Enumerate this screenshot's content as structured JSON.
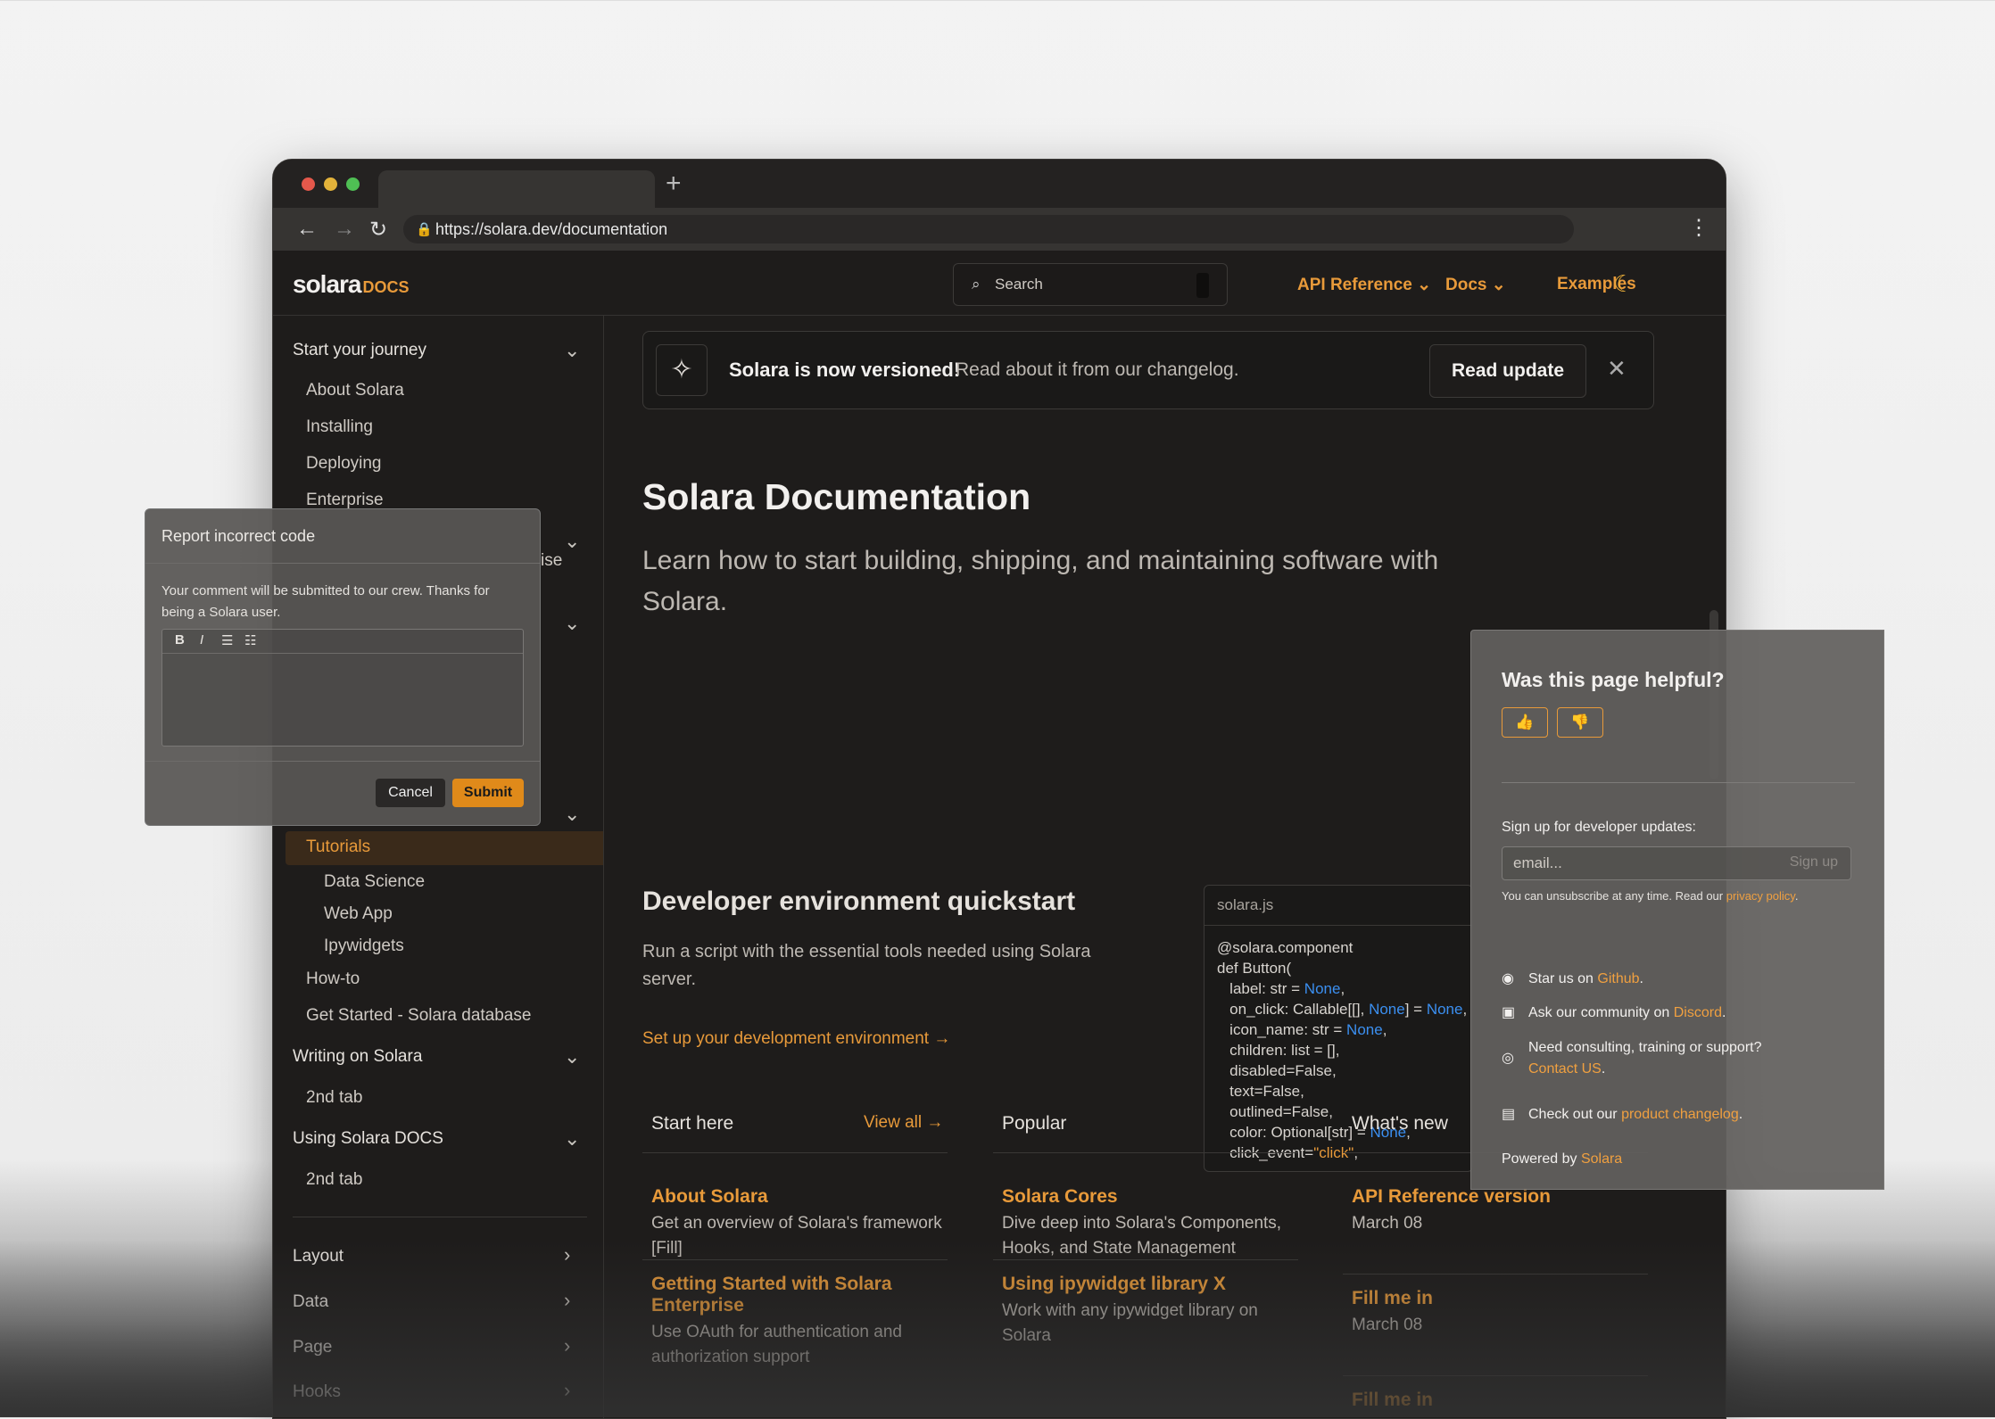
{
  "browser": {
    "url": "https://solara.dev/documentation",
    "dots": [
      "#e5584b",
      "#e2b23a",
      "#4fbf54"
    ]
  },
  "header": {
    "logo": "solara",
    "logo_suffix": "DOCS",
    "search_placeholder": "Search",
    "nav": [
      {
        "label": "API Reference"
      },
      {
        "label": "Docs"
      },
      {
        "label": "Examples"
      }
    ]
  },
  "sidebar": {
    "sections": [
      {
        "label": "Start your journey",
        "items": [
          "About Solara",
          "Installing",
          "Deploying",
          "Enterprise"
        ]
      },
      {
        "partial": "ise"
      },
      {
        "active": "Tutorials",
        "children": [
          "Data Science",
          "Web App",
          "Ipywidgets"
        ],
        "more": [
          "How-to",
          "Get Started - Solara database"
        ]
      },
      {
        "label": "Writing on Solara",
        "items": [
          "2nd tab"
        ]
      },
      {
        "label": "Using Solara DOCS",
        "items": [
          "2nd tab"
        ]
      }
    ],
    "bottom": [
      "Layout",
      "Data",
      "Page",
      "Hooks"
    ]
  },
  "banner": {
    "title": "Solara is now versioned!",
    "text": "Read about it from our changelog.",
    "button": "Read update"
  },
  "main": {
    "title": "Solara Documentation",
    "lead": "Learn how to start building, shipping, and maintaining software with Solara.",
    "quickstart_title": "Developer environment quickstart",
    "quickstart_text": "Run a script with the essential tools needed using Solara server.",
    "quickstart_link": "Set up your development environment"
  },
  "code": {
    "filename": "solara.js"
  },
  "columns": [
    {
      "heading": "Start here",
      "view_all": "View all",
      "items": [
        {
          "title": "About Solara",
          "desc": "Get an overview of Solara's framework [Fill]"
        },
        {
          "title": "Getting Started with Solara Enterprise",
          "desc": "Use OAuth for authentication and authorization support"
        }
      ]
    },
    {
      "heading": "Popular",
      "items": [
        {
          "title": "Solara Cores",
          "desc": "Dive deep into Solara's Components, Hooks, and State Management"
        },
        {
          "title": "Using ipywidget library X",
          "desc": "Work with any ipywidget library on Solara"
        }
      ]
    },
    {
      "heading": "What's new",
      "items": [
        {
          "title": "API Reference version",
          "desc": "March 08"
        },
        {
          "title": "Fill me in",
          "desc": "March 08"
        },
        {
          "title": "Fill me in",
          "desc": ""
        }
      ]
    }
  ],
  "report": {
    "title": "Report incorrect code",
    "message": "Your comment will be submitted to our crew. Thanks for being a Solara user.",
    "cancel": "Cancel",
    "submit": "Submit"
  },
  "helpful": {
    "title": "Was this page helpful?",
    "signup_label": "Sign up for developer updates:",
    "email_placeholder": "email...",
    "signup_button": "Sign up",
    "unsubscribe": "You can unsubscribe at any time. Read our",
    "privacy": "privacy policy",
    "star_pre": "Star us on",
    "star_link": "Github",
    "community_pre": "Ask our community on",
    "community_link": "Discord",
    "consult_pre": "Need consulting, training or support?",
    "consult_link": "Contact US",
    "changelog_pre": "Check out our",
    "changelog_link": "product changelog",
    "powered_pre": "Powered by",
    "powered_link": "Solara"
  }
}
